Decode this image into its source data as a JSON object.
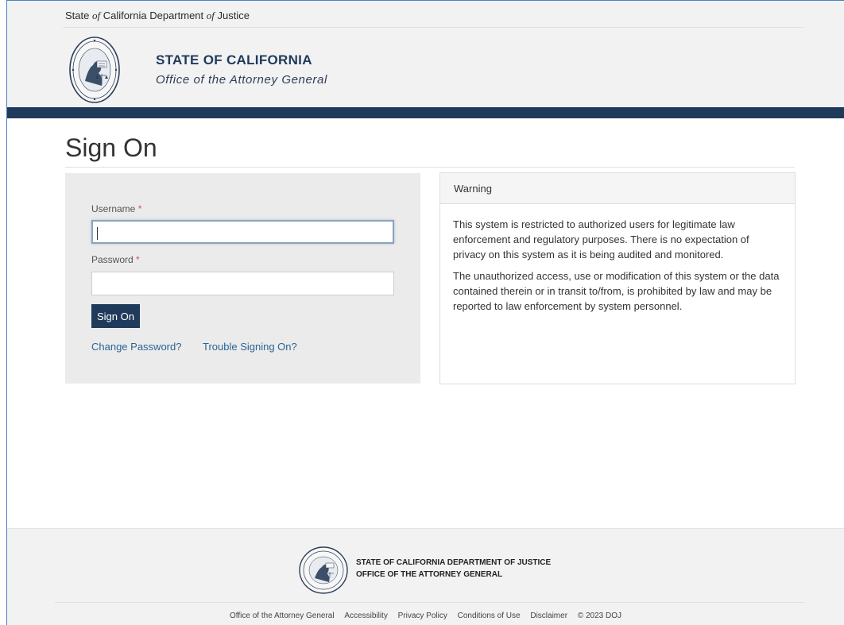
{
  "header": {
    "utility_prefix": "State ",
    "utility_of1": "of",
    "utility_mid": " California Department ",
    "utility_of2": "of",
    "utility_suffix": " Justice",
    "brand_title": "STATE OF CALIFORNIA",
    "brand_subtitle": "Office of the Attorney General",
    "seal_icon": "attorney-general-seal"
  },
  "page": {
    "title": "Sign On"
  },
  "login": {
    "username_label": "Username",
    "password_label": "Password",
    "required_marker": "*",
    "username_value": "",
    "password_value": "",
    "signon_label": "Sign On",
    "change_password_label": "Change Password?",
    "trouble_label": "Trouble Signing On?"
  },
  "warning": {
    "heading": "Warning",
    "paragraph1": "This system is restricted to authorized users for legitimate law enforcement and regulatory purposes. There is no expectation of privacy on this system as it is being audited and monitored.",
    "paragraph2": "The unauthorized access, use or modification of this system or the data contained therein or in transit to/from, is prohibited by law and may be reported to law enforcement by system personnel."
  },
  "footer": {
    "name_line1": "STATE OF CALIFORNIA DEPARTMENT OF JUSTICE",
    "name_line2": "OFFICE OF THE ATTORNEY GENERAL",
    "links": [
      "Office of the Attorney General",
      "Accessibility",
      "Privacy Policy",
      "Conditions of Use",
      "Disclaimer"
    ],
    "copyright": "© 2023 DOJ"
  },
  "colors": {
    "brand_navy": "#1f3a5b",
    "link_blue": "#2a6496",
    "required_red": "#d9534f",
    "panel_gray": "#ebebeb"
  }
}
